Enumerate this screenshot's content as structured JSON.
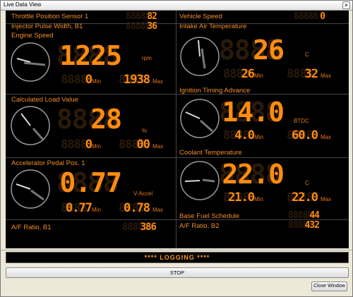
{
  "window": {
    "title": "Live Data View",
    "close_glyph": "×"
  },
  "left": {
    "tps": {
      "label": "Throttle Position Sensor 1",
      "value": "82"
    },
    "ipw": {
      "label": "Injector Pulse Width, B1",
      "value": "36"
    },
    "engine_speed": {
      "label": "Engine Speed",
      "value": "1225",
      "unit": "rpm",
      "min": "0",
      "max": "1938",
      "min_label": "Min",
      "max_label": "Max"
    },
    "load": {
      "label": "Calculated Load Value",
      "value": "28",
      "unit": "%",
      "min": "0",
      "max": "00",
      "min_label": "Min",
      "max_label": "Max"
    },
    "accel": {
      "label": "Accelerator Pedal Pos. 1",
      "value": "0.77",
      "unit": "V-Accel",
      "min": "0.77",
      "max": "0.78",
      "min_label": "Min",
      "max_label": "Max"
    },
    "afr": {
      "label": "A/F Ratio, B1",
      "value": "386"
    }
  },
  "right": {
    "vspeed": {
      "label": "Vehicle Speed",
      "value": "0"
    },
    "iat": {
      "label": "Intake Air Temperature",
      "value": "26",
      "unit": "C",
      "min": "26",
      "max": "32",
      "min_label": "Min",
      "max_label": "Max"
    },
    "timing": {
      "label": "Ignition Timing Advance",
      "value": "14.0",
      "unit": "BTDC",
      "min": "4.0",
      "max": "60.0",
      "min_label": "Min",
      "max_label": "Max"
    },
    "coolant": {
      "label": "Coolant Temperature",
      "value": "22.0",
      "unit": "C",
      "min": "21.0",
      "max": "22.0",
      "min_label": "Min",
      "max_label": "Max"
    },
    "bfs": {
      "label": "Base Fuel Schedule",
      "value": "44"
    },
    "afr2": {
      "label": "A/F Ratio, B2",
      "value": "432"
    }
  },
  "ghost": {
    "g2": "88",
    "g3": "888",
    "g4": "8888",
    "g5": "88888"
  },
  "status": {
    "logging": "**** LOGGING ****"
  },
  "buttons": {
    "stop": "STOP",
    "close": "Close Window"
  },
  "colors": {
    "accent": "#ff8c10",
    "label": "#f08c2a",
    "background": "#000000"
  }
}
